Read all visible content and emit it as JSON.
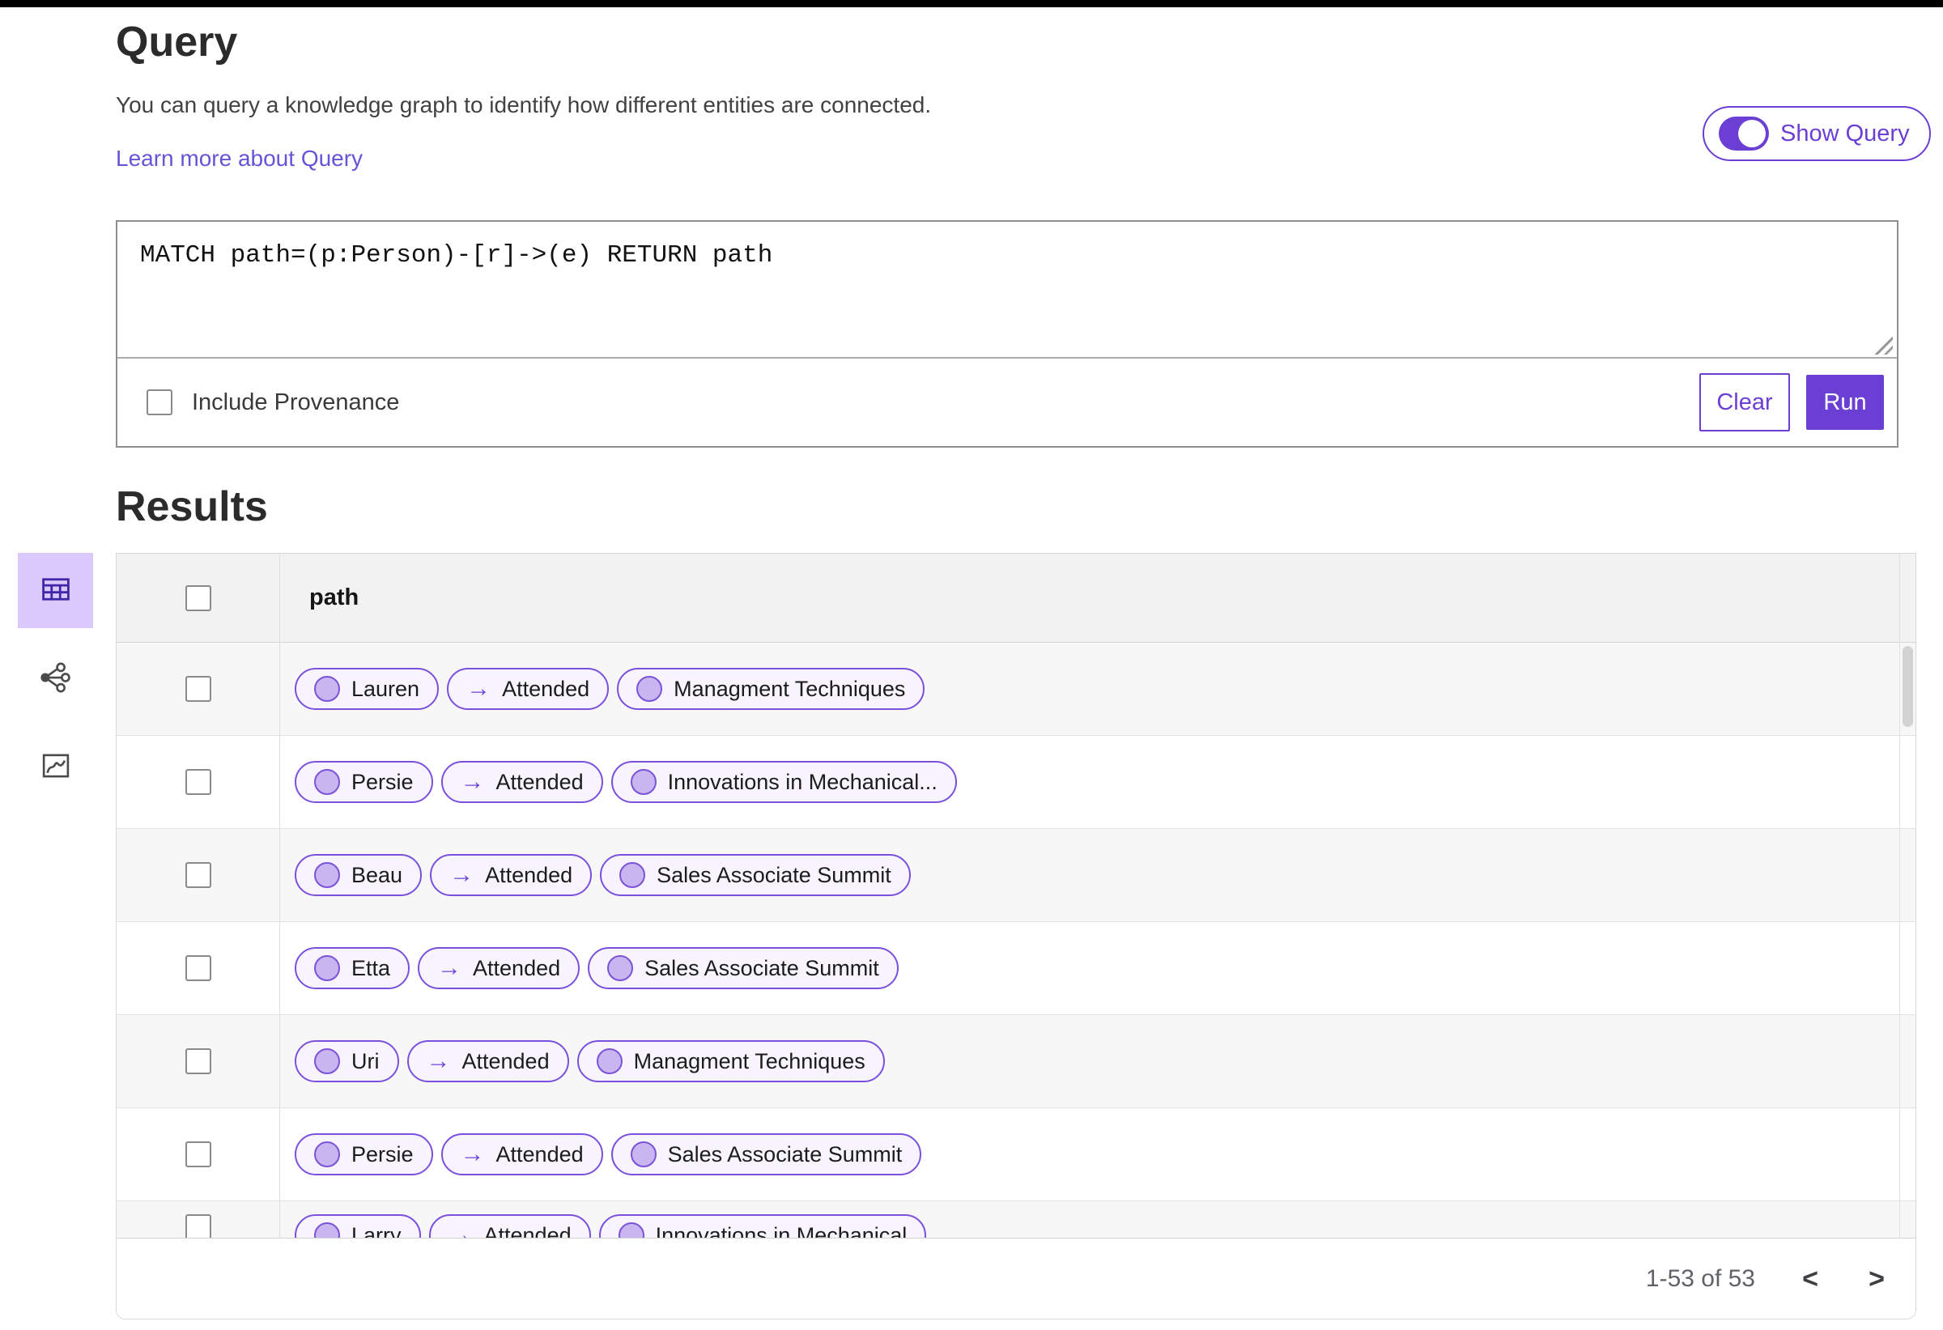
{
  "header": {
    "title": "Query",
    "description": "You can query a knowledge graph to identify how different entities are connected.",
    "learn_more": "Learn more about Query",
    "show_query_label": "Show Query",
    "show_query_on": true
  },
  "query_editor": {
    "query_text": "MATCH path=(p:Person)-[r]->(e) RETURN path",
    "include_provenance_label": "Include Provenance",
    "include_provenance_checked": false,
    "clear_label": "Clear",
    "run_label": "Run"
  },
  "results": {
    "title": "Results",
    "column_header": "path",
    "select_all_checked": false,
    "rows": [
      {
        "source": "Lauren",
        "edge": "Attended",
        "target": "Managment Techniques"
      },
      {
        "source": "Persie",
        "edge": "Attended",
        "target": "Innovations in Mechanical..."
      },
      {
        "source": "Beau",
        "edge": "Attended",
        "target": "Sales Associate Summit"
      },
      {
        "source": "Etta",
        "edge": "Attended",
        "target": "Sales Associate Summit"
      },
      {
        "source": "Uri",
        "edge": "Attended",
        "target": "Managment Techniques"
      },
      {
        "source": "Persie",
        "edge": "Attended",
        "target": "Sales Associate Summit"
      },
      {
        "source": "Larry",
        "edge": "Attended",
        "target": "Innovations in Mechanical"
      }
    ],
    "pagination": {
      "range_text": "1-53 of 53"
    }
  },
  "view_toolbar": {
    "views": [
      "table",
      "graph",
      "chart"
    ],
    "selected": "table"
  },
  "icons": {
    "edge_arrow": "→",
    "prev": "<",
    "next": ">"
  },
  "colors": {
    "accent": "#6B3FD4",
    "pill_border": "#7A50DC",
    "pill_bg": "#F7F4FE",
    "node_circle": "#C9B6F0",
    "selected_view_bg": "#DCC9FC",
    "table_header_bg": "#F2F2F2",
    "zebra_row_bg": "#F7F7F7",
    "link": "#6455D8"
  }
}
